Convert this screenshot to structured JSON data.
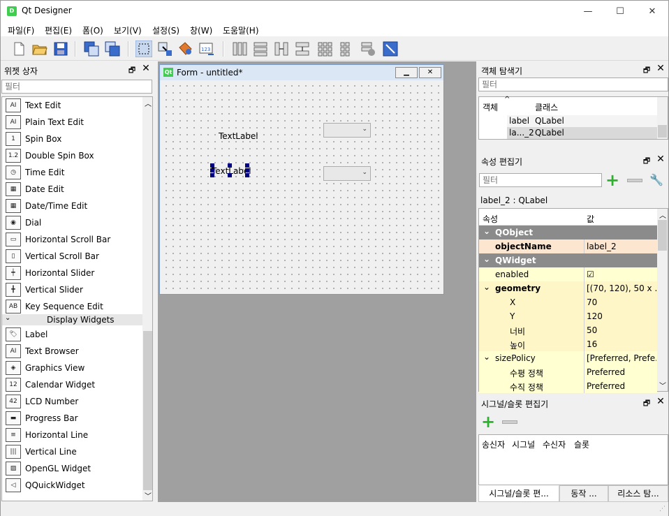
{
  "app": {
    "title": "Qt Designer",
    "icon": "qt-designer-icon",
    "minimize": "—",
    "maximize": "☐",
    "close": "✕"
  },
  "menu": [
    "파일(F)",
    "편집(E)",
    "폼(O)",
    "보기(V)",
    "설정(S)",
    "창(W)",
    "도움말(H)"
  ],
  "widget_box": {
    "title": "위젯 상자",
    "filter_placeholder": "필터",
    "items": [
      {
        "label": "Text Edit",
        "icon": "AI"
      },
      {
        "label": "Plain Text Edit",
        "icon": "AI"
      },
      {
        "label": "Spin Box",
        "icon": "1"
      },
      {
        "label": "Double Spin Box",
        "icon": "1.2"
      },
      {
        "label": "Time Edit",
        "icon": "◷"
      },
      {
        "label": "Date Edit",
        "icon": "▦"
      },
      {
        "label": "Date/Time Edit",
        "icon": "▦"
      },
      {
        "label": "Dial",
        "icon": "◉"
      },
      {
        "label": "Horizontal Scroll Bar",
        "icon": "▭"
      },
      {
        "label": "Vertical Scroll Bar",
        "icon": "▯"
      },
      {
        "label": "Horizontal Slider",
        "icon": "┿"
      },
      {
        "label": "Vertical Slider",
        "icon": "╋"
      },
      {
        "label": "Key Sequence Edit",
        "icon": "AB"
      }
    ],
    "category": "Display Widgets",
    "display_items": [
      {
        "label": "Label",
        "icon": "🏷"
      },
      {
        "label": "Text Browser",
        "icon": "AI"
      },
      {
        "label": "Graphics View",
        "icon": "◈"
      },
      {
        "label": "Calendar Widget",
        "icon": "12"
      },
      {
        "label": "LCD Number",
        "icon": "42"
      },
      {
        "label": "Progress Bar",
        "icon": "▬"
      },
      {
        "label": "Horizontal Line",
        "icon": "≡"
      },
      {
        "label": "Vertical Line",
        "icon": "|||"
      },
      {
        "label": "OpenGL Widget",
        "icon": "▨"
      },
      {
        "label": "QQuickWidget",
        "icon": "◁"
      }
    ]
  },
  "form": {
    "title": "Form - untitled*",
    "label1": "TextLabel",
    "label2": "TextLabel"
  },
  "object_inspector": {
    "title": "객체 탐색기",
    "filter_placeholder": "필터",
    "col_object": "객체",
    "col_class": "클래스",
    "rows": [
      {
        "object": "label",
        "class": "QLabel"
      },
      {
        "object": "la..._2",
        "class": "QLabel"
      }
    ]
  },
  "property_editor": {
    "title": "속성 편집기",
    "filter_placeholder": "필터",
    "context": "label_2 : QLabel",
    "col_property": "속성",
    "col_value": "값",
    "rows": [
      {
        "type": "group",
        "name": "QObject",
        "value": ""
      },
      {
        "type": "sel",
        "name": "objectName",
        "value": "label_2"
      },
      {
        "type": "group",
        "name": "QWidget",
        "value": ""
      },
      {
        "type": "y1",
        "name": "enabled",
        "value": "☑"
      },
      {
        "type": "y2",
        "name": "geometry",
        "value": "[(70, 120), 50 x ..."
      },
      {
        "type": "y2c",
        "name": "X",
        "value": "70"
      },
      {
        "type": "y2c",
        "name": "Y",
        "value": "120"
      },
      {
        "type": "y2c",
        "name": "너비",
        "value": "50"
      },
      {
        "type": "y2c",
        "name": "높이",
        "value": "16"
      },
      {
        "type": "y1",
        "name": "sizePolicy",
        "value": "[Preferred, Prefe..."
      },
      {
        "type": "y1c",
        "name": "수평 정책",
        "value": "Preferred"
      },
      {
        "type": "y1c",
        "name": "수직 정책",
        "value": "Preferred"
      }
    ]
  },
  "signal_slot": {
    "title": "시그널/슬롯 편집기",
    "cols": [
      "송신자",
      "시그널",
      "수신자",
      "슬롯"
    ]
  },
  "tabs": [
    "시그널/슬롯 편...",
    "동작 ...",
    "리소스 탐..."
  ],
  "colors": {
    "group": "#8b8b8b",
    "selected": "#fde6cf",
    "yellow": "#ffffd1"
  }
}
